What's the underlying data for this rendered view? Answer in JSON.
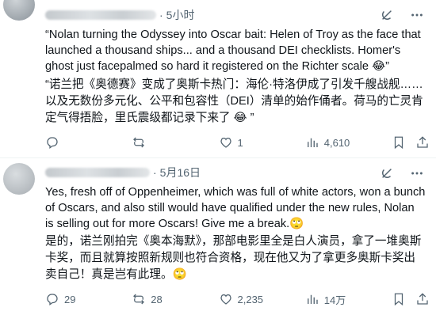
{
  "posts": [
    {
      "time": "5小时",
      "text_en": "“Nolan turning the Odyssey into Oscar bait: Helen of Troy as the face that launched a thousand ships... and a thousand DEI checklists. Homer's ghost just facepalmed so hard it registered on the Richter scale 😂”",
      "text_zh": "“诺兰把《奥德赛》变成了奥斯卡热门：海伦·特洛伊成了引发千艘战舰……以及无数份多元化、公平和包容性（DEI）清单的始作俑者。荷马的亡灵肯定气得捂脸，里氏震级都记录下来了 😂 ”",
      "replies": "",
      "retweets": "",
      "likes": "1",
      "views": "4,610"
    },
    {
      "time": "5月16日",
      "text_en": "Yes, fresh off of Oppenheimer, which was full of white actors, won a bunch of Oscars, and also still would have qualified under the new rules, Nolan is selling out for more Oscars! Give me a break.🙄",
      "text_zh": "是的，诺兰刚拍完《奥本海默》，那部电影里全是白人演员，拿了一堆奥斯卡奖，而且就算按照新规则也符合资格，现在他又为了拿更多奥斯卡奖出卖自己！真是岂有此理。🙄",
      "replies": "29",
      "retweets": "28",
      "likes": "2,235",
      "views": "14万"
    }
  ],
  "icons": {
    "grok": "grok-icon",
    "more": "more-icon",
    "reply": "reply-icon",
    "retweet": "retweet-icon",
    "like": "like-icon",
    "views": "views-icon",
    "bookmark": "bookmark-icon",
    "share": "share-icon"
  },
  "colors": {
    "text": "#0f1419",
    "secondary": "#536471",
    "divider": "#eff3f4"
  }
}
